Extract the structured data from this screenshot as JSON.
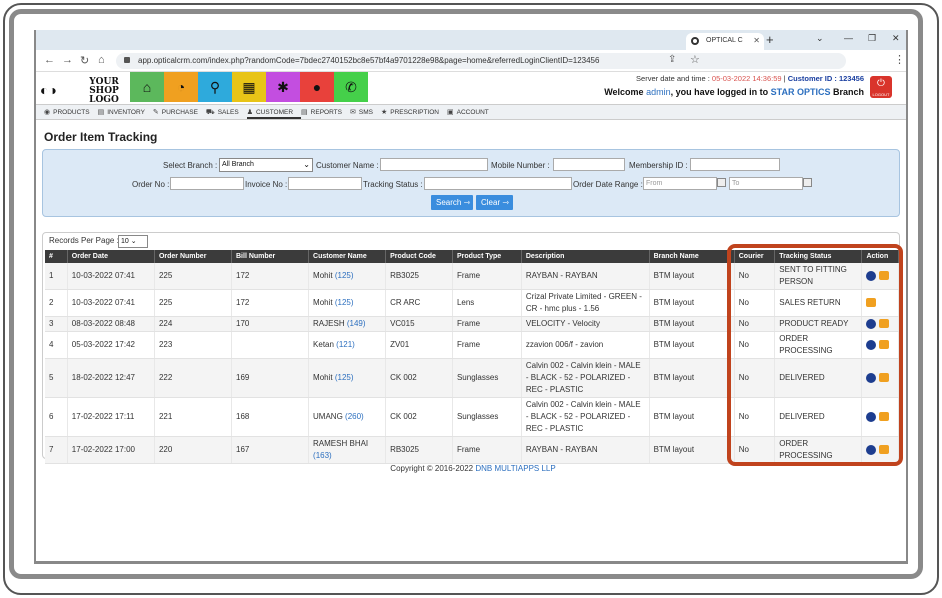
{
  "browser": {
    "tab_title": "OPTICAL C",
    "url": "app.opticalcrm.com/index.php?randomCode=7bdec2740152bc8e57bf4a9701228e98&page=home&referredLoginClientID=123456"
  },
  "header": {
    "logo_line1": "YOUR",
    "logo_line2": "SHOP LOGO",
    "server_label": "Server date and time :",
    "server_time": "05-03-2022 14:36:59",
    "customer_id": "Customer ID : 123456",
    "welcome_prefix": "Welcome",
    "welcome_user": "admin",
    "welcome_mid": ", you have logged in to",
    "welcome_branch": "STAR OPTICS",
    "welcome_suffix": "Branch",
    "logout_label": "LOGOUT"
  },
  "nav_icons": [
    {
      "name": "home-icon",
      "color": "#5cb85c",
      "glyph": "⌂"
    },
    {
      "name": "dashboard-icon",
      "color": "#f0a020",
      "glyph": "◔"
    },
    {
      "name": "search-icon",
      "color": "#2eaadc",
      "glyph": "⚲"
    },
    {
      "name": "grid-icon",
      "color": "#e8c417",
      "glyph": "▦"
    },
    {
      "name": "settings-icon",
      "color": "#c34ee0",
      "glyph": "✱"
    },
    {
      "name": "user-icon",
      "color": "#e8413b",
      "glyph": "●"
    },
    {
      "name": "whatsapp-icon",
      "color": "#45d04a",
      "glyph": "✆"
    }
  ],
  "menu": [
    "PRODUCTS",
    "INVENTORY",
    "PURCHASE",
    "SALES",
    "CUSTOMER",
    "REPORTS",
    "SMS",
    "PRESCRIPTION",
    "ACCOUNT"
  ],
  "page_title": "Order Item Tracking",
  "filter": {
    "select_branch_label": "Select Branch :",
    "select_branch_value": "All Branch",
    "customer_name_label": "Customer Name :",
    "mobile_label": "Mobile Number :",
    "membership_label": "Membership ID :",
    "order_no_label": "Order No :",
    "invoice_label": "Invoice No :",
    "tracking_label": "Tracking Status :",
    "date_range_label": "Order Date Range :",
    "from_placeholder": "From",
    "to_placeholder": "To",
    "search_btn": "Search",
    "clear_btn": "Clear"
  },
  "records_label": "Records Per Page :",
  "records_value": "10",
  "table": {
    "headers": [
      "#",
      "Order Date",
      "Order Number",
      "Bill Number",
      "Customer Name",
      "Product Code",
      "Product Type",
      "Description",
      "Branch Name",
      "Courier",
      "Tracking Status",
      "Action"
    ],
    "rows": [
      {
        "n": "1",
        "date": "10-03-2022 07:41",
        "order": "225",
        "bill": "172",
        "cust": "Mohit",
        "cid": "(125)",
        "code": "RB3025",
        "type": "Frame",
        "desc": "RAYBAN - RAYBAN",
        "branch": "BTM layout",
        "courier": "No",
        "status": "SENT TO FITTING PERSON",
        "view": true
      },
      {
        "n": "2",
        "date": "10-03-2022 07:41",
        "order": "225",
        "bill": "172",
        "cust": "Mohit",
        "cid": "(125)",
        "code": "CR ARC",
        "type": "Lens",
        "desc": "Crizal Private Limited - GREEN - CR - hmc plus - 1.56",
        "branch": "BTM layout",
        "courier": "No",
        "status": "SALES RETURN",
        "view": false
      },
      {
        "n": "3",
        "date": "08-03-2022 08:48",
        "order": "224",
        "bill": "170",
        "cust": "RAJESH",
        "cid": "(149)",
        "code": "VC015",
        "type": "Frame",
        "desc": "VELOCITY - Velocity",
        "branch": "BTM layout",
        "courier": "No",
        "status": "PRODUCT READY",
        "view": true
      },
      {
        "n": "4",
        "date": "05-03-2022 17:42",
        "order": "223",
        "bill": "",
        "cust": "Ketan",
        "cid": "(121)",
        "code": "ZV01",
        "type": "Frame",
        "desc": "zzavion 006/f - zavion",
        "branch": "BTM layout",
        "courier": "No",
        "status": "ORDER PROCESSING",
        "view": true
      },
      {
        "n": "5",
        "date": "18-02-2022 12:47",
        "order": "222",
        "bill": "169",
        "cust": "Mohit",
        "cid": "(125)",
        "code": "CK 002",
        "type": "Sunglasses",
        "desc": "Calvin 002 - Calvin klein - MALE - BLACK - 52 - POLARIZED - REC - PLASTIC",
        "branch": "BTM layout",
        "courier": "No",
        "status": "DELIVERED",
        "view": true
      },
      {
        "n": "6",
        "date": "17-02-2022 17:11",
        "order": "221",
        "bill": "168",
        "cust": "UMANG",
        "cid": "(260)",
        "code": "CK 002",
        "type": "Sunglasses",
        "desc": "Calvin 002 - Calvin klein - MALE - BLACK - 52 - POLARIZED - REC - PLASTIC",
        "branch": "BTM layout",
        "courier": "No",
        "status": "DELIVERED",
        "view": true
      },
      {
        "n": "7",
        "date": "17-02-2022 17:00",
        "order": "220",
        "bill": "167",
        "cust": "RAMESH BHAI",
        "cid": "(163)",
        "code": "RB3025",
        "type": "Frame",
        "desc": "RAYBAN - RAYBAN",
        "branch": "BTM layout",
        "courier": "No",
        "status": "ORDER PROCESSING",
        "view": true
      }
    ]
  },
  "copyright_prefix": "Copyright © 2016-2022",
  "copyright_link": "DNB MULTIAPPS LLP"
}
